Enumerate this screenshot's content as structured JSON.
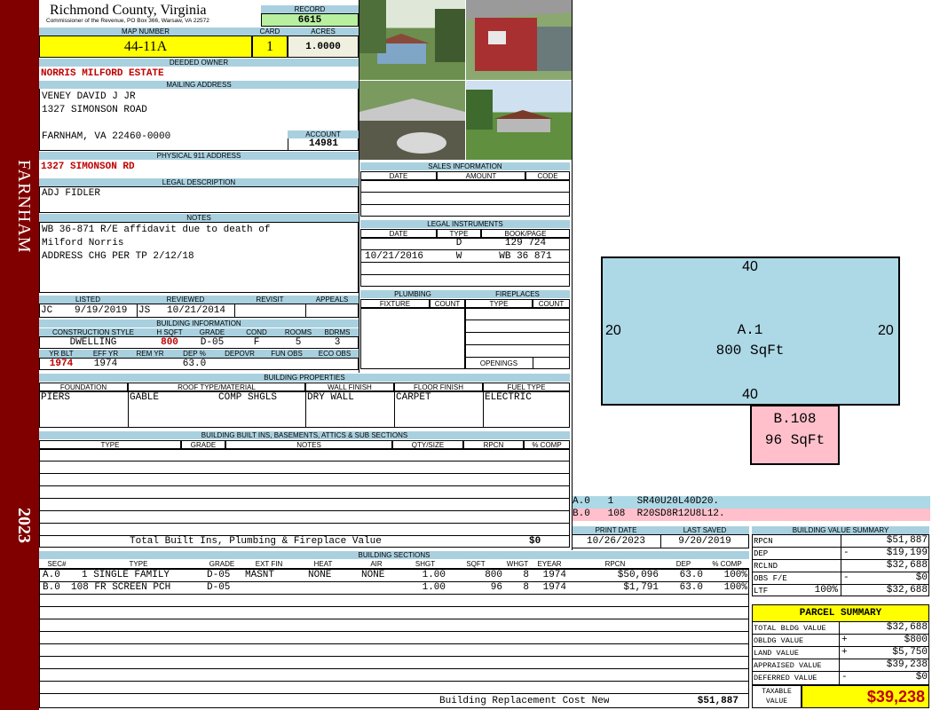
{
  "sidebar": {
    "town": "FARNHAM",
    "year": "2023"
  },
  "header": {
    "county": "Richmond County, Virginia",
    "commissioner": "Commissioner of the Revenue, PO Box 366, Warsaw, VA 22572",
    "record_label": "RECORD",
    "record": "6615",
    "map_label": "MAP NUMBER",
    "map_number": "44-11A",
    "card_label": "CARD",
    "card": "1",
    "acres_label": "ACRES",
    "acres": "1.0000"
  },
  "owner": {
    "deeded_label": "DEEDED OWNER",
    "deeded": "NORRIS MILFORD ESTATE",
    "mailing_label": "MAILING ADDRESS",
    "mailing_lines": [
      "VENEY DAVID J JR",
      "1327 SIMONSON ROAD",
      "",
      "FARNHAM, VA 22460-0000"
    ],
    "account_label": "ACCOUNT",
    "account": "14981",
    "phys_label": "PHYSICAL 911 ADDRESS",
    "phys": "1327 SIMONSON RD"
  },
  "legal": {
    "label": "LEGAL DESCRIPTION",
    "text": "ADJ FIDLER"
  },
  "notes": {
    "label": "NOTES",
    "lines": [
      "WB 36-871 R/E affidavit due to death of",
      "Milford Norris",
      "ADDRESS CHG PER TP 2/12/18"
    ]
  },
  "review": {
    "listed_label": "LISTED",
    "listed_by": "JC",
    "listed": "9/19/2019",
    "reviewed_label": "REVIEWED",
    "reviewed_by": "JS",
    "reviewed": "10/21/2014",
    "revisit_label": "REVISIT",
    "appeals_label": "APPEALS"
  },
  "building_info": {
    "label": "BUILDING INFORMATION",
    "h": [
      "CONSTRUCTION STYLE",
      "H SQFT",
      "GRADE",
      "COND",
      "ROOMS",
      "BDRMS"
    ],
    "v": [
      "DWELLING",
      "800",
      "D-05",
      "F",
      "5",
      "3"
    ],
    "h2": [
      "YR BLT",
      "EFF YR",
      "REM YR",
      "DEP %",
      "DEPOVR",
      "FUN OBS",
      "ECO OBS"
    ],
    "v2": [
      "1974",
      "1974",
      "",
      "63.0",
      "",
      "",
      ""
    ]
  },
  "sales": {
    "label": "SALES INFORMATION",
    "cols": [
      "DATE",
      "AMOUNT",
      "CODE"
    ]
  },
  "legal_instruments": {
    "label": "LEGAL INSTRUMENTS",
    "cols": [
      "DATE",
      "TYPE",
      "BOOK/PAGE"
    ],
    "rows": [
      [
        "",
        "D",
        "129 724"
      ],
      [
        "10/21/2016",
        "W",
        "WB 36 871"
      ]
    ]
  },
  "plumbing": {
    "label": "PLUMBING",
    "cols": [
      "FIXTURE",
      "COUNT"
    ]
  },
  "fireplaces": {
    "label": "FIREPLACES",
    "cols": [
      "TYPE",
      "COUNT"
    ],
    "openings": "OPENINGS"
  },
  "properties": {
    "label": "BUILDING PROPERTIES",
    "cols": [
      "FOUNDATION",
      "ROOF TYPE/MATERIAL",
      "WALL FINISH",
      "FLOOR FINISH",
      "FUEL TYPE"
    ],
    "vals": [
      "PIERS",
      "GABLE",
      "COMP SHGLS",
      "DRY WALL",
      "CARPET",
      "ELECTRIC"
    ]
  },
  "builtins": {
    "label": "BUILDING BUILT INS, BASEMENTS, ATTICS & SUB SECTIONS",
    "cols": [
      "TYPE",
      "GRADE",
      "NOTES",
      "QTY/SIZE",
      "RPCN",
      "% COMP"
    ],
    "total_label": "Total Built Ins, Plumbing & Fireplace Value",
    "total": "$0"
  },
  "dates": {
    "print_label": "PRINT DATE",
    "print": "10/26/2023",
    "saved_label": "LAST SAVED",
    "saved": "9/20/2019"
  },
  "sketch": {
    "a_label": "A.1",
    "a_area": "800 SqFt",
    "top": "40",
    "bottom": "40",
    "left": "20",
    "right": "20",
    "b_label": "B.108",
    "b_area": "96 SqFt",
    "code_a": "A.0   1    SR40U20L40D20.",
    "code_b": "B.0   108  R20SD8R12U8L12.",
    "color_a": "#add8e6",
    "color_b": "#ffc0cb"
  },
  "value_summary": {
    "label": "BUILDING VALUE SUMMARY",
    "rows": [
      {
        "k": "RPCN",
        "s": "",
        "v": "$51,887"
      },
      {
        "k": "DEP",
        "s": "-",
        "v": "$19,199"
      },
      {
        "k": "RCLND",
        "s": "",
        "v": "$32,688"
      },
      {
        "k": "OBS F/E",
        "s": "-",
        "v": "$0"
      },
      {
        "k": "LTF",
        "p": "100%",
        "s": "",
        "v": "$32,688"
      }
    ]
  },
  "sections": {
    "label": "BUILDING SECTIONS",
    "cols": [
      "SEC#",
      "TYPE",
      "GRADE",
      "EXT FIN",
      "HEAT",
      "AIR",
      "SHGT",
      "SQFT",
      "WHGT",
      "EYEAR",
      "RPCN",
      "DEP",
      "% COMP"
    ],
    "rows": [
      [
        "A.0",
        "1 SINGLE FAMILY",
        "D-05",
        "MASNT",
        "NONE",
        "NONE",
        "1.00",
        "800",
        "8",
        "1974",
        "$50,096",
        "63.0",
        "100%"
      ],
      [
        "B.0",
        "108 FR SCREEN PCH",
        "D-05",
        "",
        "",
        "",
        "1.00",
        "96",
        "8",
        "1974",
        "$1,791",
        "63.0",
        "100%"
      ]
    ],
    "total_label": "Building Replacement Cost New",
    "total": "$51,887"
  },
  "parcel": {
    "label": "PARCEL SUMMARY",
    "rows": [
      {
        "k": "TOTAL BLDG VALUE",
        "s": "",
        "v": "$32,688"
      },
      {
        "k": "OBLDG VALUE",
        "s": "+",
        "v": "$800"
      },
      {
        "k": "LAND VALUE",
        "s": "+",
        "v": "$5,750"
      },
      {
        "k": "APPRAISED VALUE",
        "s": "",
        "v": "$39,238"
      },
      {
        "k": "DEFERRED VALUE",
        "s": "-",
        "v": "$0"
      }
    ],
    "taxable_label": "TAXABLE VALUE",
    "taxable": "$39,238"
  },
  "colors": {
    "sidebar": "#800000",
    "header_blue": "#a9d0df",
    "yellow": "#ffff00",
    "record_green": "#b8f0a0"
  }
}
